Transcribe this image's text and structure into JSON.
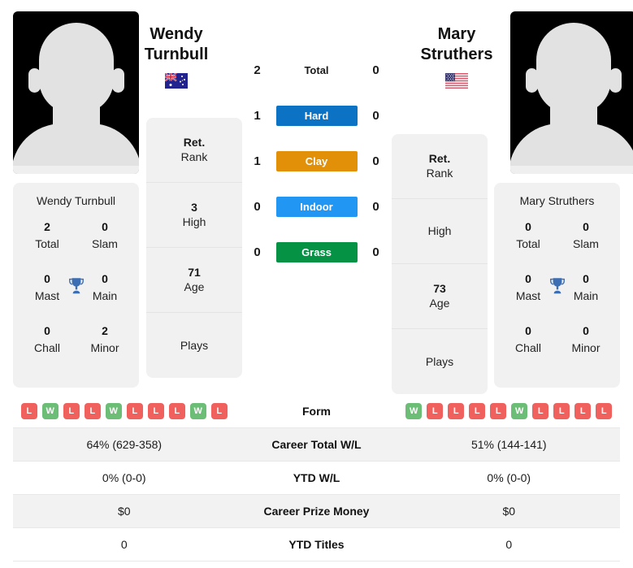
{
  "players": {
    "left": {
      "name": "Wendy Turnbull",
      "name_line1": "Wendy",
      "name_line2": "Turnbull",
      "flag": "australia-flag",
      "card_name": "Wendy Turnbull",
      "titles": {
        "total": "2",
        "total_label": "Total",
        "slam": "0",
        "slam_label": "Slam",
        "mast": "0",
        "mast_label": "Mast",
        "main": "0",
        "main_label": "Main",
        "chall": "0",
        "chall_label": "Chall",
        "minor": "2",
        "minor_label": "Minor"
      },
      "info": {
        "rank_value": "Ret.",
        "rank_label": "Rank",
        "high_value": "3",
        "high_label": "High",
        "age_value": "71",
        "age_label": "Age",
        "plays_value": "",
        "plays_label": "Plays"
      },
      "form": [
        "L",
        "W",
        "L",
        "L",
        "W",
        "L",
        "L",
        "L",
        "W",
        "L"
      ],
      "career_total_wl": "64% (629-358)",
      "ytd_wl": "0% (0-0)",
      "career_prize_money": "$0",
      "ytd_titles": "0"
    },
    "right": {
      "name": "Mary Struthers",
      "name_line1": "Mary",
      "name_line2": "Struthers",
      "flag": "usa-flag",
      "card_name": "Mary Struthers",
      "titles": {
        "total": "0",
        "total_label": "Total",
        "slam": "0",
        "slam_label": "Slam",
        "mast": "0",
        "mast_label": "Mast",
        "main": "0",
        "main_label": "Main",
        "chall": "0",
        "chall_label": "Chall",
        "minor": "0",
        "minor_label": "Minor"
      },
      "info": {
        "rank_value": "Ret.",
        "rank_label": "Rank",
        "high_value": "",
        "high_label": "High",
        "age_value": "73",
        "age_label": "Age",
        "plays_value": "",
        "plays_label": "Plays"
      },
      "form": [
        "W",
        "L",
        "L",
        "L",
        "L",
        "W",
        "L",
        "L",
        "L",
        "L"
      ],
      "career_total_wl": "51% (144-141)",
      "ytd_wl": "0% (0-0)",
      "career_prize_money": "$0",
      "ytd_titles": "0"
    }
  },
  "surfaces": [
    {
      "label": "Total",
      "left": "2",
      "right": "0",
      "color": "",
      "chip": false
    },
    {
      "label": "Hard",
      "left": "1",
      "right": "0",
      "color": "#0b72c4",
      "chip": true
    },
    {
      "label": "Clay",
      "left": "1",
      "right": "0",
      "color": "#e29008",
      "chip": true
    },
    {
      "label": "Indoor",
      "left": "0",
      "right": "0",
      "color": "#2196f3",
      "chip": true
    },
    {
      "label": "Grass",
      "left": "0",
      "right": "0",
      "color": "#059245",
      "chip": true
    }
  ],
  "table_rows": [
    {
      "label": "Form",
      "type": "form"
    },
    {
      "label": "Career Total W/L",
      "type": "text",
      "left": "64% (629-358)",
      "right": "51% (144-141)"
    },
    {
      "label": "YTD W/L",
      "type": "text",
      "left": "0% (0-0)",
      "right": "0% (0-0)"
    },
    {
      "label": "Career Prize Money",
      "type": "text",
      "left": "$0",
      "right": "$0"
    },
    {
      "label": "YTD Titles",
      "type": "text",
      "left": "0",
      "right": "0"
    }
  ],
  "colors": {
    "win": "#6cbd75",
    "loss": "#f0605d",
    "trophy": "#3c6eb4",
    "card_bg": "#f1f1f1",
    "row_alt": "#f2f2f2"
  }
}
